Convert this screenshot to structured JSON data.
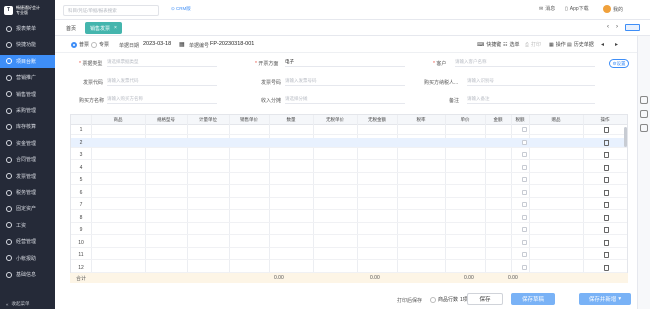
{
  "app": {
    "name": "畅捷通好会计",
    "sub": "专业版",
    "logo": "T"
  },
  "sidebar": {
    "items": [
      "报表菜单",
      "快捷功能",
      "项目台账",
      "营销推广",
      "销售管理",
      "采购管理",
      "库存核算",
      "资金管理",
      "合同管理",
      "发票管理",
      "税务管理",
      "固定资产",
      "工资",
      "经营管理",
      "小帐报助",
      "基础信息"
    ],
    "active_index": 2,
    "collapse": "收起菜单"
  },
  "topbar": {
    "search_placeholder": "科目/凭证/单据/报表搜索",
    "link": "CRM版",
    "messages": "消息",
    "app": "App下载",
    "user": "我的"
  },
  "tabs": {
    "home": "首页",
    "active": "销售发票"
  },
  "toolbar": {
    "type_normal": "普票",
    "type_special": "专票",
    "date_label": "单据日期",
    "date": "2023-03-18",
    "no_label": "单据编号",
    "no": "FP-20230318-001",
    "tools": [
      "快捷键",
      "选单",
      "打印",
      "操作"
    ],
    "attach": "历史单据",
    "page_nav": [
      "‹",
      "›"
    ]
  },
  "form": {
    "f1_label": "票据类型",
    "f1_value": "请选择票据类型",
    "f2_label": "开票方面",
    "f2_value": "电子",
    "f3_label": "客户",
    "f3_value": "请输入客户名称",
    "setting": "设置",
    "f4_label": "发票代码",
    "f4_value": "请输入发票代码",
    "f5_label": "发票号码",
    "f5_value": "请输入发票号码",
    "f6_label": "购买方纳税人...",
    "f6_value": "请输入识别号",
    "f7_label": "购买方名称",
    "f7_value": "请输入购买方名称",
    "f8_label": "收入分摊",
    "f8_value": "请选择分摊",
    "f9_label": "备注",
    "f9_value": "请输入备注"
  },
  "grid": {
    "headers": [
      "",
      "商品",
      "规格型号",
      "计量单位",
      "销售单价",
      "数量",
      "无税单价",
      "无税金额",
      "税率",
      "单价",
      "金额",
      "税额",
      "赠品",
      "操作"
    ],
    "rows": [
      "1",
      "2",
      "3",
      "4",
      "5",
      "6",
      "7",
      "8",
      "9",
      "10",
      "11",
      "12"
    ],
    "selected_row": 1
  },
  "totals": {
    "label": "合计",
    "qty": "0.00",
    "notax": "0.00",
    "amount": "0.00",
    "tax": "0.00"
  },
  "footer": {
    "print": "打印后保存",
    "check_label": "商品行数",
    "check_value": "1项",
    "save": "保存",
    "save_draft": "保存草稿",
    "save_new": "保存并新增"
  },
  "colors": {
    "sidebar": "#252a38",
    "accent": "#3e8ef7",
    "tab": "#44b5ad"
  }
}
